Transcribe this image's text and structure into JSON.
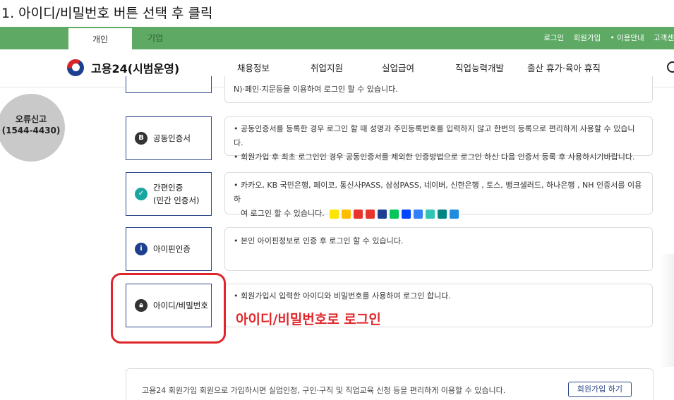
{
  "caption": "1. 아이디/비밀번호 버튼 선택 후 클릭",
  "topbar": {
    "tab_personal": "개인",
    "tab_business": "기업",
    "util": [
      "로그인",
      "회원가입",
      "• 이용안내",
      "고객센"
    ]
  },
  "header": {
    "logo_text": "고용24(시범운영)",
    "menu": [
      "채용정보",
      "취업지원",
      "실업급여",
      "직업능력개발",
      "출산 휴가·육아 휴직"
    ]
  },
  "report": {
    "line1": "오류신고",
    "line2": "(1544-4430)"
  },
  "partial_top_text": "N)·페인·지문등을 이용하여 로그인 할 수 있습니다.",
  "methods": [
    {
      "label": "공동인증서",
      "icon": "certificate-icon",
      "desc": [
        "공동인증서를 등록한 경우 로그인 할 때 성명과 주민등록번호를 입력하지 않고 한번의 등록으로 편리하게 사용할 수 있습니다.",
        "회원가입 후 최초 로그인인 경우 공동인증서를 제외한 인증방법으로 로그인 하신 다음 인증서 등록 후 사용하시기바랍니다."
      ]
    },
    {
      "label": "간편인증",
      "label2": "(민간 인증서)",
      "icon": "shield-check-icon",
      "desc": [
        "카카오, KB 국민은행, 페이코, 통신사PASS, 삼성PASS, 네이버, 신한은행 , 토스, 뱅크샐러드, 하나은행 , NH 인증서를 이용하",
        "여 로그인 할 수 있습니다."
      ]
    },
    {
      "label": "아이핀인증",
      "icon": "info-icon",
      "desc": [
        "본인 아이핀정보로 인증 후 로그인 할 수 있습니다."
      ]
    },
    {
      "label": "아이디/비밀번호",
      "icon": "lock-icon",
      "desc": [
        "회원가입시 입력한 아이디와 비밀번호를 사용하여 로그인 합니다."
      ]
    }
  ],
  "annotation": "아이디/비밀번호로 로그인",
  "bottom": {
    "text": "고용24 회원가입   회원으로 가입하시면 실업인정, 구인·구직 및 직업교육 신청 등을 편리하게 이용할 수 있습니다.",
    "button": "회원가입 하기"
  },
  "colors": {
    "green": "#5ea964",
    "navy": "#2f4a8a",
    "red": "#e0262b"
  }
}
